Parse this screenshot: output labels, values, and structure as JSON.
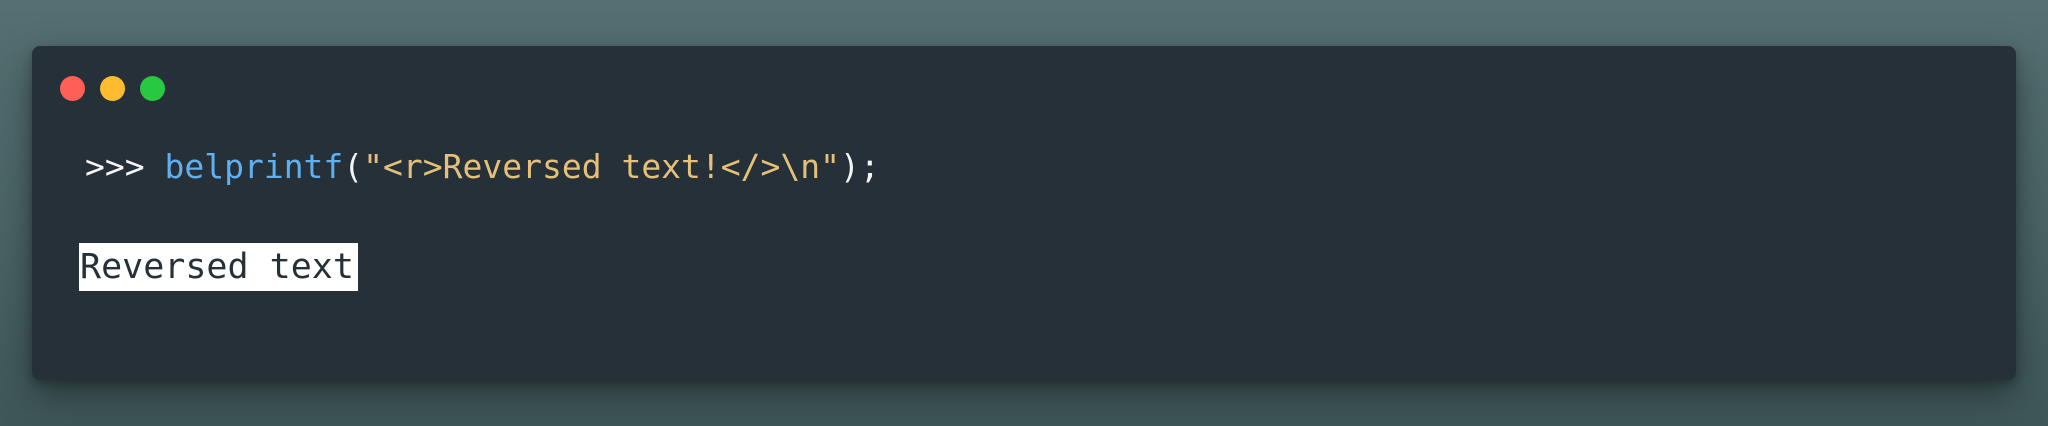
{
  "window": {
    "controls": [
      "close-control",
      "minimize-control",
      "zoom-control"
    ]
  },
  "terminal": {
    "prompt": ">>>",
    "function_name": "belprintf",
    "open_paren": "(",
    "string_literal": "\"<r>Reversed text!</>\\n\"",
    "close_paren": ");",
    "output_text": "Reversed text"
  },
  "colors": {
    "background": "#4f6a6c",
    "window": "#263038",
    "function": "#61afef",
    "string": "#e5c07b",
    "text": "#f5f5f5",
    "output_highlight_bg": "#ffffff",
    "output_highlight_fg": "#263038"
  }
}
